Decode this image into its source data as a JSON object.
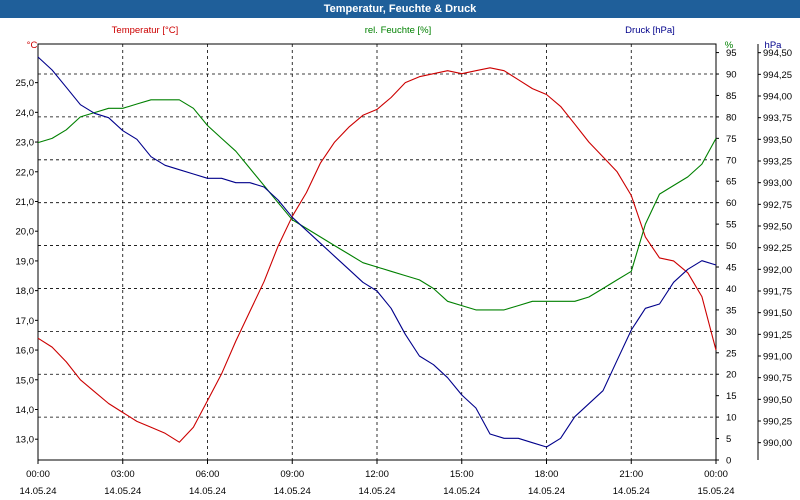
{
  "window": {
    "title": "Temperatur, Feuchte & Druck"
  },
  "colors": {
    "temperature": "#cc0000",
    "humidity": "#008000",
    "pressure": "#00008b",
    "title_bar": "#1f5f9a",
    "grid": "#000000"
  },
  "chart_data": {
    "type": "line",
    "title": "Temperatur, Feuchte & Druck",
    "grid": true,
    "x_range_hours": [
      0,
      24
    ],
    "x_ticks": [
      {
        "time": "00:00",
        "date": "14.05.24"
      },
      {
        "time": "03:00",
        "date": "14.05.24"
      },
      {
        "time": "06:00",
        "date": "14.05.24"
      },
      {
        "time": "09:00",
        "date": "14.05.24"
      },
      {
        "time": "12:00",
        "date": "14.05.24"
      },
      {
        "time": "15:00",
        "date": "14.05.24"
      },
      {
        "time": "18:00",
        "date": "14.05.24"
      },
      {
        "time": "21:00",
        "date": "14.05.24"
      },
      {
        "time": "00:00",
        "date": "15.05.24"
      }
    ],
    "axes": {
      "temperature": {
        "label": "Temperatur [°C]",
        "unit": "°C",
        "range": [
          12.3,
          26.3
        ],
        "ticks": [
          "13,0",
          "14,0",
          "15,0",
          "16,0",
          "17,0",
          "18,0",
          "19,0",
          "20,0",
          "21,0",
          "22,0",
          "23,0",
          "24,0",
          "25,0"
        ]
      },
      "humidity": {
        "label": "rel. Feuchte [%]",
        "unit": "%",
        "range": [
          0,
          97
        ],
        "ticks": [
          "0",
          "5",
          "10",
          "15",
          "20",
          "25",
          "30",
          "35",
          "40",
          "45",
          "50",
          "55",
          "60",
          "65",
          "70",
          "75",
          "80",
          "85",
          "90",
          "95"
        ]
      },
      "pressure": {
        "label": "Druck [hPa]",
        "unit": "hPa",
        "range": [
          989.8,
          994.6
        ],
        "ticks": [
          "990,00",
          "990,25",
          "990,50",
          "990,75",
          "991,00",
          "991,25",
          "991,50",
          "991,75",
          "992,00",
          "992,25",
          "992,50",
          "992,75",
          "993,00",
          "993,25",
          "993,50",
          "993,75",
          "994,00",
          "994,25",
          "994,50"
        ]
      }
    },
    "series": [
      {
        "name": "Temperatur [°C]",
        "axis": "temperature",
        "x": [
          0,
          0.5,
          1,
          1.5,
          2,
          2.5,
          3,
          3.5,
          4,
          4.5,
          5,
          5.5,
          6,
          6.5,
          7,
          7.5,
          8,
          8.5,
          9,
          9.5,
          10,
          10.5,
          11,
          11.5,
          12,
          12.5,
          13,
          13.5,
          14,
          14.5,
          15,
          15.5,
          16,
          16.5,
          17,
          17.5,
          18,
          18.5,
          19,
          19.5,
          20,
          20.5,
          21,
          21.5,
          22,
          22.5,
          23,
          23.5,
          24
        ],
        "y": [
          16.4,
          16.1,
          15.6,
          15.0,
          14.6,
          14.2,
          13.9,
          13.6,
          13.4,
          13.2,
          12.9,
          13.4,
          14.3,
          15.2,
          16.3,
          17.3,
          18.3,
          19.5,
          20.5,
          21.3,
          22.3,
          23.0,
          23.5,
          23.9,
          24.1,
          24.5,
          25.0,
          25.2,
          25.3,
          25.4,
          25.3,
          25.4,
          25.5,
          25.4,
          25.1,
          24.8,
          24.6,
          24.2,
          23.6,
          23.0,
          22.5,
          22.0,
          21.2,
          19.8,
          19.1,
          19.0,
          18.6,
          17.8,
          16.0
        ]
      },
      {
        "name": "rel. Feuchte [%]",
        "axis": "humidity",
        "x": [
          0,
          0.5,
          1,
          1.5,
          2,
          2.5,
          3,
          3.5,
          4,
          4.5,
          5,
          5.5,
          6,
          6.5,
          7,
          7.5,
          8,
          8.5,
          9,
          9.5,
          10,
          10.5,
          11,
          11.5,
          12,
          12.5,
          13,
          13.5,
          14,
          14.5,
          15,
          15.5,
          16,
          16.5,
          17,
          17.5,
          18,
          18.5,
          19,
          19.5,
          20,
          20.5,
          21,
          21.5,
          22,
          22.5,
          23,
          23.5,
          24
        ],
        "y": [
          74,
          75,
          77,
          80,
          81,
          82,
          82,
          83,
          84,
          84,
          84,
          82,
          78,
          75,
          72,
          68,
          64,
          60,
          56,
          54,
          52,
          50,
          48,
          46,
          45,
          44,
          43,
          42,
          40,
          37,
          36,
          35,
          35,
          35,
          36,
          37,
          37,
          37,
          37,
          38,
          40,
          42,
          44,
          55,
          62,
          64,
          66,
          69,
          75
        ]
      },
      {
        "name": "Druck [hPa]",
        "axis": "pressure",
        "x": [
          0,
          0.5,
          1,
          1.5,
          2,
          2.5,
          3,
          3.5,
          4,
          4.5,
          5,
          5.5,
          6,
          6.5,
          7,
          7.5,
          8,
          8.5,
          9,
          9.5,
          10,
          10.5,
          11,
          11.5,
          12,
          12.5,
          13,
          13.5,
          14,
          14.5,
          15,
          15.5,
          16,
          16.5,
          17,
          17.5,
          18,
          18.5,
          19,
          19.5,
          20,
          20.5,
          21,
          21.5,
          22,
          22.5,
          23,
          23.5,
          24
        ],
        "y": [
          994.45,
          994.3,
          994.1,
          993.9,
          993.8,
          993.75,
          993.6,
          993.5,
          993.3,
          993.2,
          993.15,
          993.1,
          993.05,
          993.05,
          993.0,
          993.0,
          992.95,
          992.8,
          992.6,
          992.45,
          992.3,
          992.15,
          992.0,
          991.85,
          991.75,
          991.55,
          991.25,
          991.0,
          990.9,
          990.75,
          990.55,
          990.4,
          990.1,
          990.05,
          990.05,
          990.0,
          989.95,
          990.05,
          990.3,
          990.45,
          990.6,
          990.95,
          991.3,
          991.55,
          991.6,
          991.85,
          992.0,
          992.1,
          992.05
        ]
      }
    ]
  }
}
